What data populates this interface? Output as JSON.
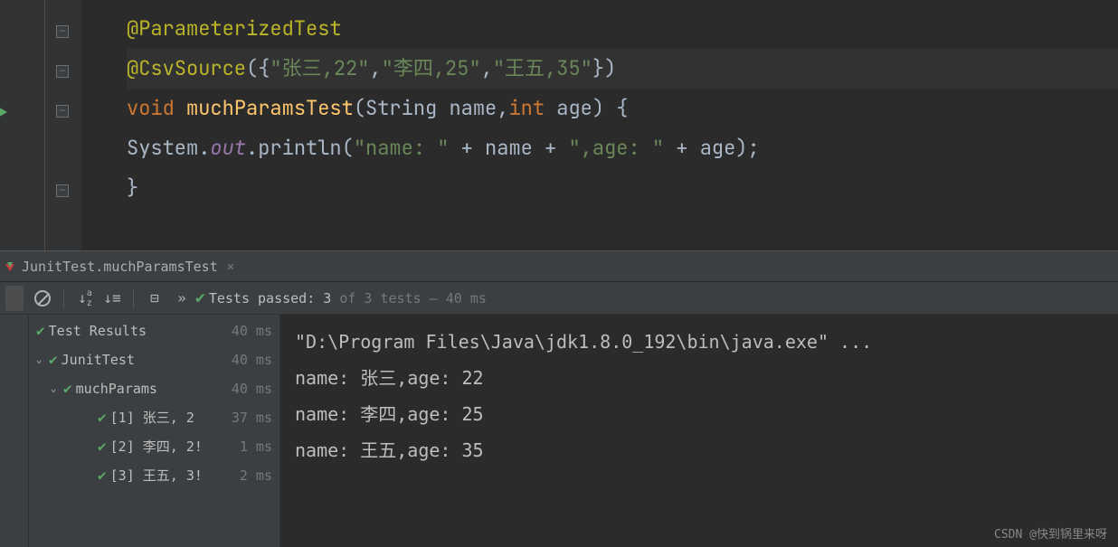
{
  "code": {
    "line1": {
      "annotation": "@ParameterizedTest"
    },
    "line2": {
      "annotation": "@CsvSource",
      "open": "({",
      "s1": "\"张三,22\"",
      "c1": ",",
      "s2": "\"李四,25\"",
      "c2": ",",
      "s3": "\"王五,35\"",
      "close": "})"
    },
    "line3": {
      "kw_void": "void",
      "method": "muchParamsTest",
      "open": "(",
      "t1": "String ",
      "p1": "name",
      "c": ",",
      "t2": "int ",
      "p2": "age",
      "close": ") {"
    },
    "line4": {
      "indent": "    ",
      "obj": "System.",
      "field": "out",
      "call": ".println(",
      "s1": "\"name: \"",
      "op1": " + ",
      "v1": "name",
      "op2": " + ",
      "s2": "\",age: \"",
      "op3": " + ",
      "v2": "age",
      "end": ");"
    },
    "line5": {
      "brace": "}"
    }
  },
  "tab": {
    "title": "JunitTest.muchParamsTest"
  },
  "toolbar": {
    "status_prefix": "Tests passed: ",
    "passed_count": "3",
    "status_suffix": " of 3 tests – 40 ms",
    "expand": "»"
  },
  "tree": {
    "header": {
      "label": "Test Results",
      "time": "40 ms"
    },
    "suite": {
      "label": "JunitTest",
      "time": "40 ms"
    },
    "test": {
      "label": "muchParams",
      "time": "40 ms"
    },
    "cases": [
      {
        "label": "[1] 张三, 2",
        "time": "37 ms"
      },
      {
        "label": "[2] 李四, 2!",
        "time": "1 ms"
      },
      {
        "label": "[3] 王五, 3!",
        "time": "2 ms"
      }
    ]
  },
  "console": {
    "cmd": "\"D:\\Program Files\\Java\\jdk1.8.0_192\\bin\\java.exe\" ...",
    "lines": [
      "name: 张三,age: 22",
      "name: 李四,age: 25",
      "name: 王五,age: 35"
    ]
  },
  "watermark": "CSDN @快到锅里来呀",
  "chart_data": null
}
